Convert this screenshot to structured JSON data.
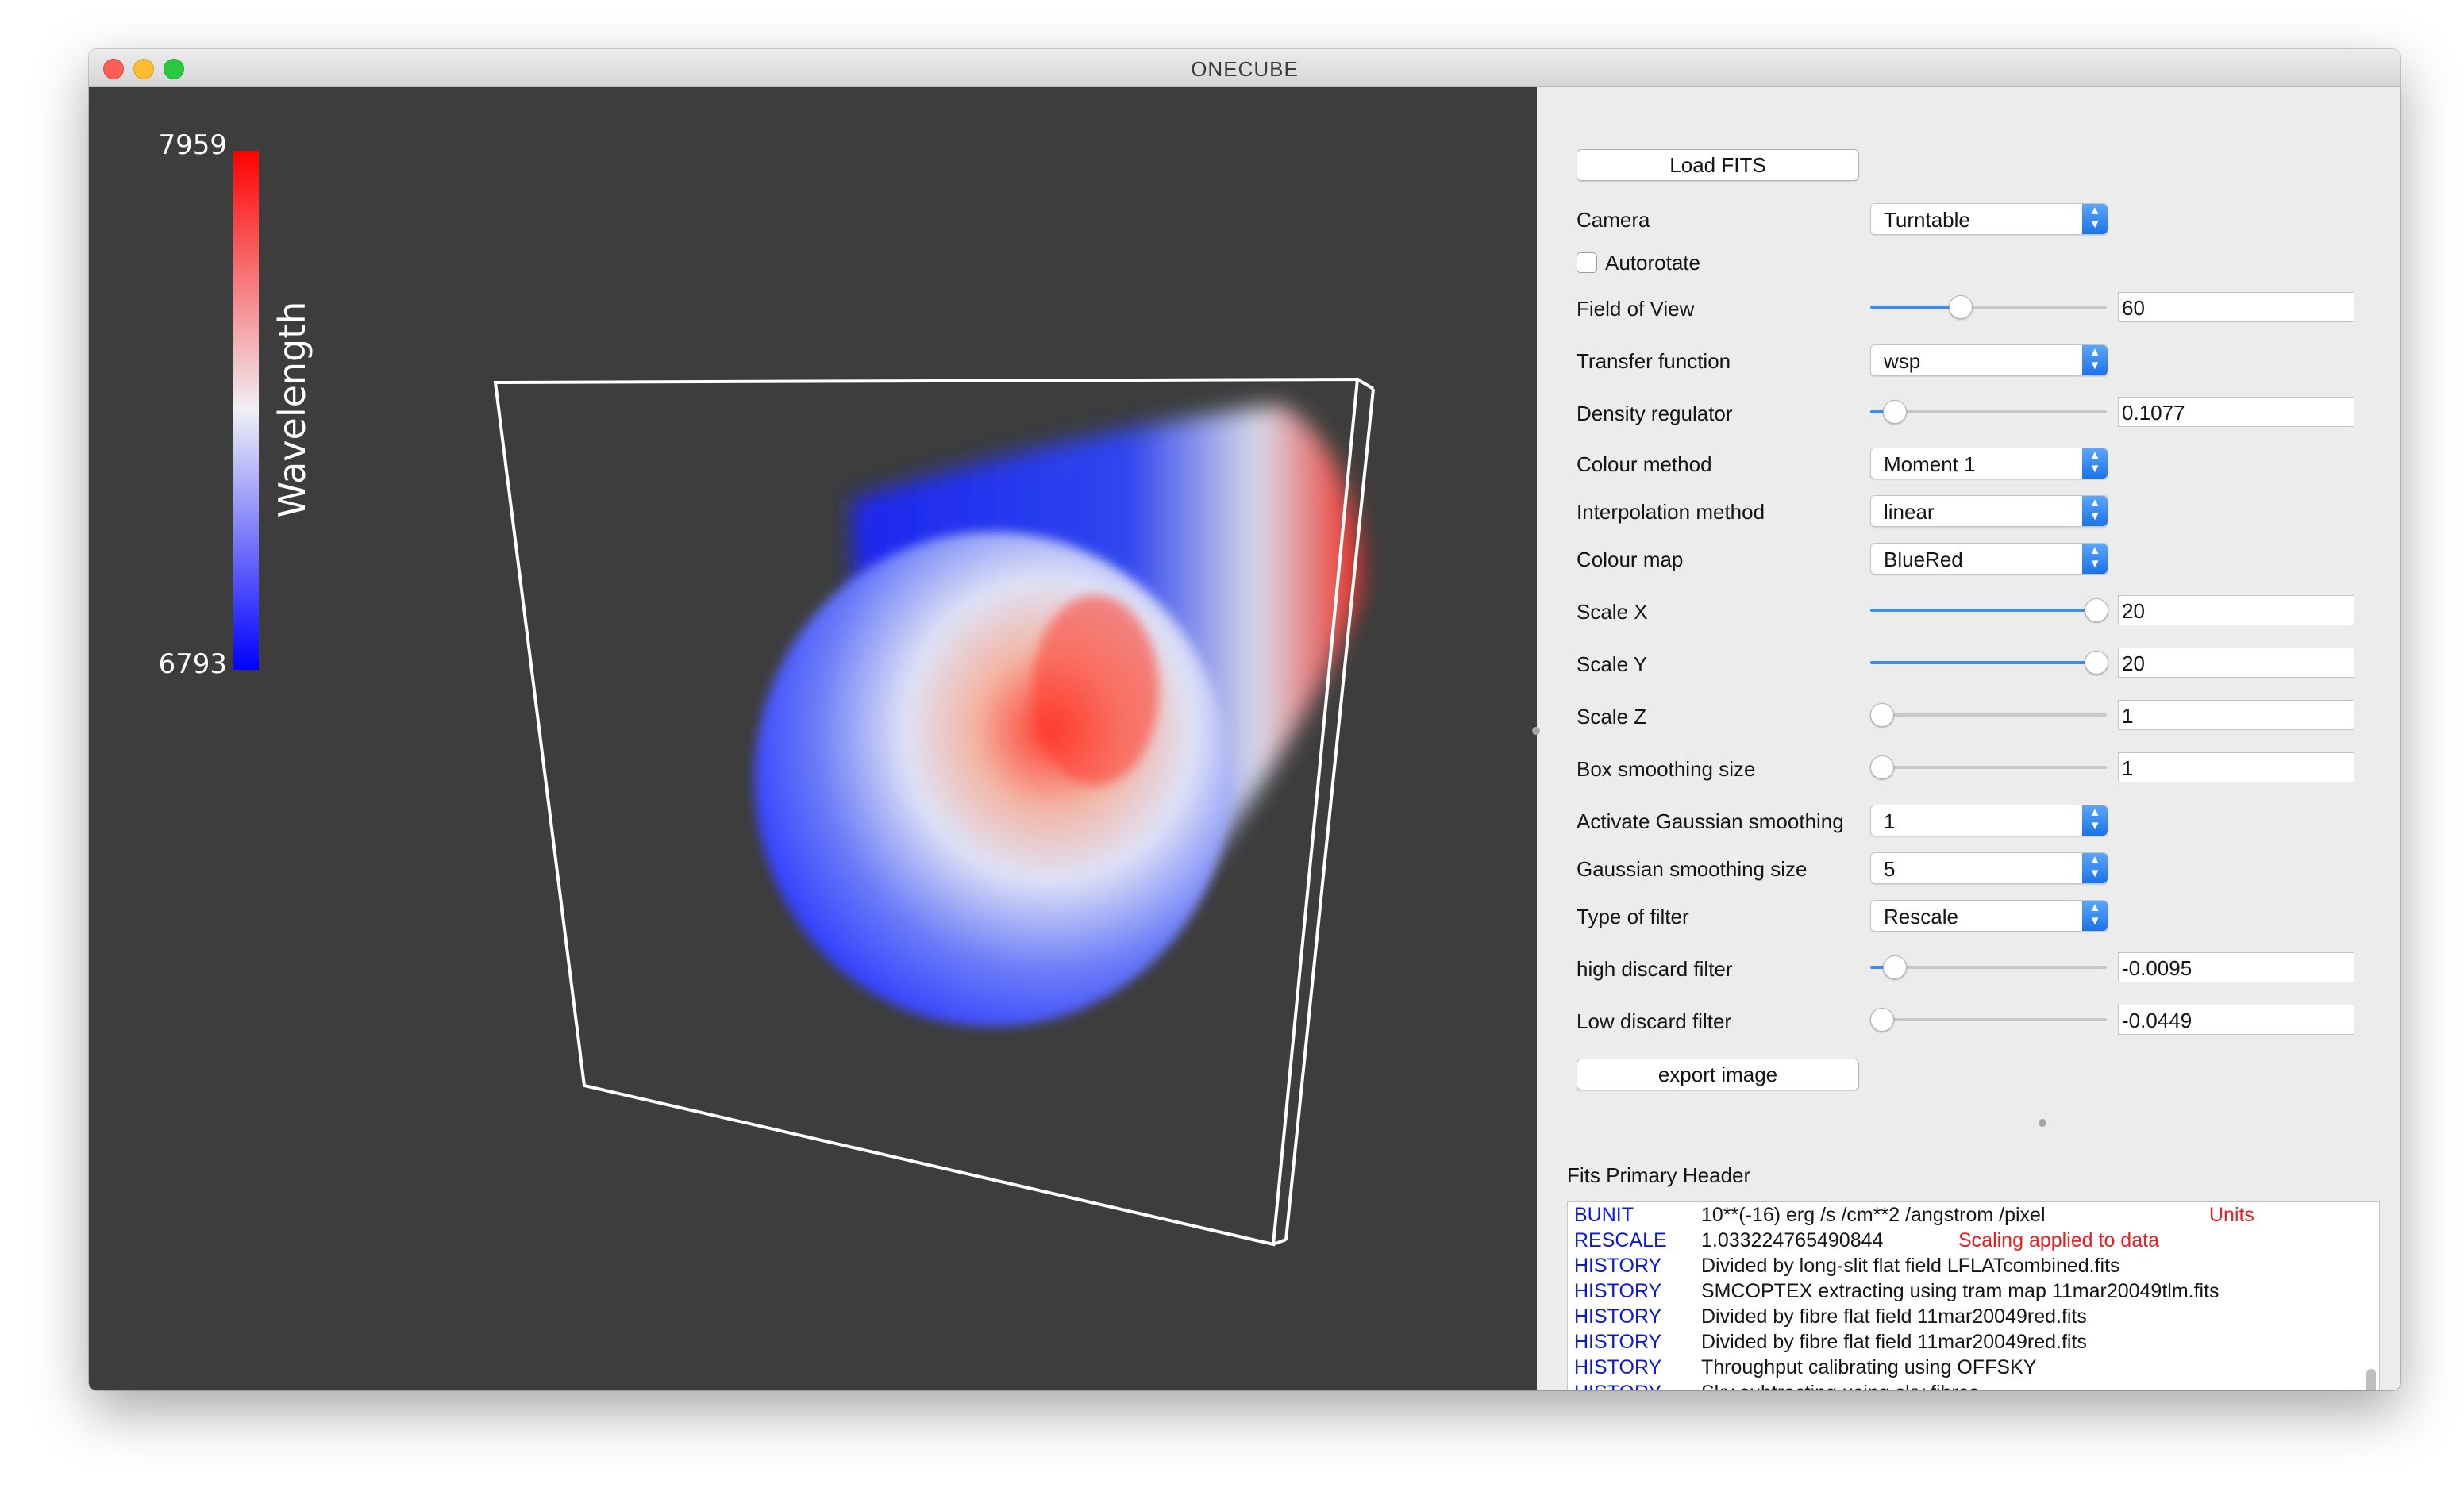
{
  "window": {
    "title": "ONECUBE"
  },
  "colorbar": {
    "max_label": "7959",
    "min_label": "6793",
    "axis_label": "Wavelength",
    "colors": {
      "low": "#0000ff",
      "mid": "#f0f0f5",
      "high": "#ff0000"
    }
  },
  "controls": {
    "load_fits": "Load FITS",
    "camera": {
      "label": "Camera",
      "value": "Turntable"
    },
    "autorotate": {
      "label": "Autorotate",
      "checked": false
    },
    "field_of_view": {
      "label": "Field of View",
      "value": "60",
      "slider_fraction": 0.38
    },
    "transfer_function": {
      "label": "Transfer function",
      "value": "wsp"
    },
    "density_regulator": {
      "label": "Density regulator",
      "value": "0.1077",
      "slider_fraction": 0.1
    },
    "colour_method": {
      "label": "Colour method",
      "value": "Moment 1"
    },
    "interpolation_method": {
      "label": "Interpolation method",
      "value": "linear"
    },
    "colour_map": {
      "label": "Colour map",
      "value": "BlueRed"
    },
    "scale_x": {
      "label": "Scale X",
      "value": "20",
      "slider_fraction": 1.0
    },
    "scale_y": {
      "label": "Scale Y",
      "value": "20",
      "slider_fraction": 1.0
    },
    "scale_z": {
      "label": "Scale Z",
      "value": "1",
      "slider_fraction": 0.0
    },
    "box_smoothing_size": {
      "label": "Box smoothing size",
      "value": "1",
      "slider_fraction": 0.0
    },
    "activate_gaussian_smoothing": {
      "label": "Activate Gaussian smoothing",
      "value": "1"
    },
    "gaussian_smoothing_size": {
      "label": "Gaussian smoothing size",
      "value": "5"
    },
    "type_of_filter": {
      "label": "Type of filter",
      "value": "Rescale"
    },
    "high_discard_filter": {
      "label": "high discard filter",
      "value": "-0.0095",
      "slider_fraction": 0.1
    },
    "low_discard_filter": {
      "label": "Low discard filter",
      "value": "-0.0449",
      "slider_fraction": 0.0
    },
    "export_image": "export image"
  },
  "fits_header": {
    "title": "Fits Primary Header",
    "colors": {
      "key": "#0b18d4",
      "comment": "#ee1c1c"
    },
    "rows": [
      {
        "key": "BUNIT",
        "value": "10**(-16) erg /s /cm**2 /angstrom /pixel",
        "comment": "Units"
      },
      {
        "key": "RESCALE",
        "value": "1.033224765490844",
        "comment": "Scaling applied to data"
      },
      {
        "key": "HISTORY",
        "value": "Divided by long-slit flat field LFLATcombined.fits",
        "comment": ""
      },
      {
        "key": "HISTORY",
        "value": "SMCOPTEX extracting using tram map 11mar20049tlm.fits",
        "comment": ""
      },
      {
        "key": "HISTORY",
        "value": "Divided by fibre flat field 11mar20049red.fits",
        "comment": ""
      },
      {
        "key": "HISTORY",
        "value": "Divided by fibre flat field 11mar20049red.fits",
        "comment": ""
      },
      {
        "key": "HISTORY",
        "value": "Throughput calibrating using OFFSKY",
        "comment": ""
      },
      {
        "key": "HISTORY",
        "value": "Sky subtracting using sky fibres",
        "comment": ""
      }
    ]
  }
}
